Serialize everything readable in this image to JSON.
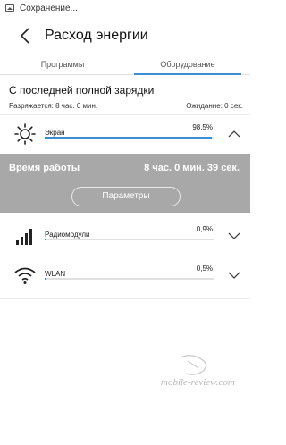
{
  "status_bar": {
    "text": "Сохранение..."
  },
  "header": {
    "title": "Расход энергии"
  },
  "tabs": [
    {
      "label": "Программы",
      "active": false
    },
    {
      "label": "Оборудование",
      "active": true
    }
  ],
  "summary": {
    "title": "С последней полной зарядки",
    "discharging": "Разряжается: 8 час. 0 мин.",
    "standby": "Ожидание: 0 сек."
  },
  "items": [
    {
      "label": "Экран",
      "value": "98,5%",
      "percent": 98.5,
      "icon": "sun-icon",
      "expanded": true
    },
    {
      "label": "Радиомодули",
      "value": "0,9%",
      "percent": 0.9,
      "icon": "signal-bars-icon",
      "expanded": false
    },
    {
      "label": "WLAN",
      "value": "0,5%",
      "percent": 0.5,
      "icon": "wifi-icon",
      "expanded": false
    }
  ],
  "detail": {
    "uptime_label": "Время работы",
    "uptime_value": "8 час. 0 мин. 39 сек.",
    "params_button": "Параметры"
  },
  "watermark": "mobile-review.com",
  "colors": {
    "accent": "#3a8bd8",
    "detail_bg": "#a8a8a8"
  }
}
